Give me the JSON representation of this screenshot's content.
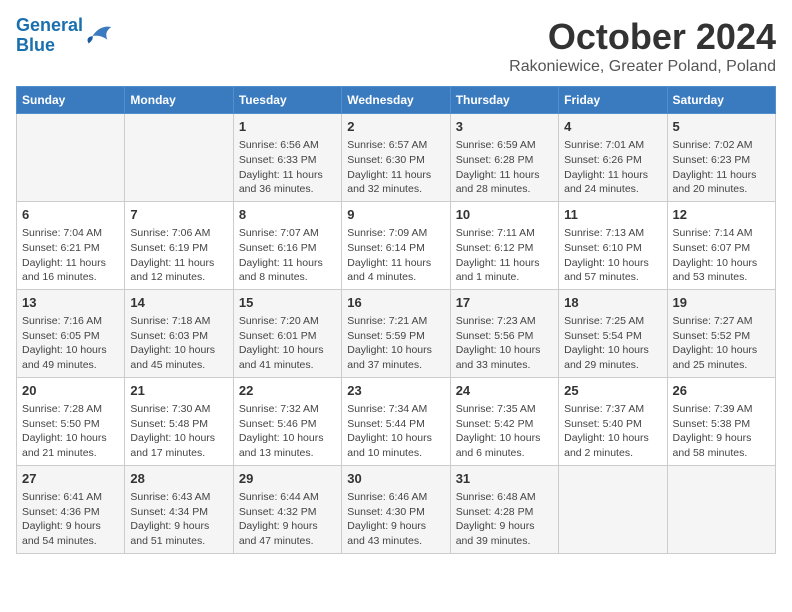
{
  "header": {
    "logo_line1": "General",
    "logo_line2": "Blue",
    "month": "October 2024",
    "location": "Rakoniewice, Greater Poland, Poland"
  },
  "days_of_week": [
    "Sunday",
    "Monday",
    "Tuesday",
    "Wednesday",
    "Thursday",
    "Friday",
    "Saturday"
  ],
  "weeks": [
    [
      {
        "day": "",
        "info": ""
      },
      {
        "day": "",
        "info": ""
      },
      {
        "day": "1",
        "info": "Sunrise: 6:56 AM\nSunset: 6:33 PM\nDaylight: 11 hours and 36 minutes."
      },
      {
        "day": "2",
        "info": "Sunrise: 6:57 AM\nSunset: 6:30 PM\nDaylight: 11 hours and 32 minutes."
      },
      {
        "day": "3",
        "info": "Sunrise: 6:59 AM\nSunset: 6:28 PM\nDaylight: 11 hours and 28 minutes."
      },
      {
        "day": "4",
        "info": "Sunrise: 7:01 AM\nSunset: 6:26 PM\nDaylight: 11 hours and 24 minutes."
      },
      {
        "day": "5",
        "info": "Sunrise: 7:02 AM\nSunset: 6:23 PM\nDaylight: 11 hours and 20 minutes."
      }
    ],
    [
      {
        "day": "6",
        "info": "Sunrise: 7:04 AM\nSunset: 6:21 PM\nDaylight: 11 hours and 16 minutes."
      },
      {
        "day": "7",
        "info": "Sunrise: 7:06 AM\nSunset: 6:19 PM\nDaylight: 11 hours and 12 minutes."
      },
      {
        "day": "8",
        "info": "Sunrise: 7:07 AM\nSunset: 6:16 PM\nDaylight: 11 hours and 8 minutes."
      },
      {
        "day": "9",
        "info": "Sunrise: 7:09 AM\nSunset: 6:14 PM\nDaylight: 11 hours and 4 minutes."
      },
      {
        "day": "10",
        "info": "Sunrise: 7:11 AM\nSunset: 6:12 PM\nDaylight: 11 hours and 1 minute."
      },
      {
        "day": "11",
        "info": "Sunrise: 7:13 AM\nSunset: 6:10 PM\nDaylight: 10 hours and 57 minutes."
      },
      {
        "day": "12",
        "info": "Sunrise: 7:14 AM\nSunset: 6:07 PM\nDaylight: 10 hours and 53 minutes."
      }
    ],
    [
      {
        "day": "13",
        "info": "Sunrise: 7:16 AM\nSunset: 6:05 PM\nDaylight: 10 hours and 49 minutes."
      },
      {
        "day": "14",
        "info": "Sunrise: 7:18 AM\nSunset: 6:03 PM\nDaylight: 10 hours and 45 minutes."
      },
      {
        "day": "15",
        "info": "Sunrise: 7:20 AM\nSunset: 6:01 PM\nDaylight: 10 hours and 41 minutes."
      },
      {
        "day": "16",
        "info": "Sunrise: 7:21 AM\nSunset: 5:59 PM\nDaylight: 10 hours and 37 minutes."
      },
      {
        "day": "17",
        "info": "Sunrise: 7:23 AM\nSunset: 5:56 PM\nDaylight: 10 hours and 33 minutes."
      },
      {
        "day": "18",
        "info": "Sunrise: 7:25 AM\nSunset: 5:54 PM\nDaylight: 10 hours and 29 minutes."
      },
      {
        "day": "19",
        "info": "Sunrise: 7:27 AM\nSunset: 5:52 PM\nDaylight: 10 hours and 25 minutes."
      }
    ],
    [
      {
        "day": "20",
        "info": "Sunrise: 7:28 AM\nSunset: 5:50 PM\nDaylight: 10 hours and 21 minutes."
      },
      {
        "day": "21",
        "info": "Sunrise: 7:30 AM\nSunset: 5:48 PM\nDaylight: 10 hours and 17 minutes."
      },
      {
        "day": "22",
        "info": "Sunrise: 7:32 AM\nSunset: 5:46 PM\nDaylight: 10 hours and 13 minutes."
      },
      {
        "day": "23",
        "info": "Sunrise: 7:34 AM\nSunset: 5:44 PM\nDaylight: 10 hours and 10 minutes."
      },
      {
        "day": "24",
        "info": "Sunrise: 7:35 AM\nSunset: 5:42 PM\nDaylight: 10 hours and 6 minutes."
      },
      {
        "day": "25",
        "info": "Sunrise: 7:37 AM\nSunset: 5:40 PM\nDaylight: 10 hours and 2 minutes."
      },
      {
        "day": "26",
        "info": "Sunrise: 7:39 AM\nSunset: 5:38 PM\nDaylight: 9 hours and 58 minutes."
      }
    ],
    [
      {
        "day": "27",
        "info": "Sunrise: 6:41 AM\nSunset: 4:36 PM\nDaylight: 9 hours and 54 minutes."
      },
      {
        "day": "28",
        "info": "Sunrise: 6:43 AM\nSunset: 4:34 PM\nDaylight: 9 hours and 51 minutes."
      },
      {
        "day": "29",
        "info": "Sunrise: 6:44 AM\nSunset: 4:32 PM\nDaylight: 9 hours and 47 minutes."
      },
      {
        "day": "30",
        "info": "Sunrise: 6:46 AM\nSunset: 4:30 PM\nDaylight: 9 hours and 43 minutes."
      },
      {
        "day": "31",
        "info": "Sunrise: 6:48 AM\nSunset: 4:28 PM\nDaylight: 9 hours and 39 minutes."
      },
      {
        "day": "",
        "info": ""
      },
      {
        "day": "",
        "info": ""
      }
    ]
  ]
}
